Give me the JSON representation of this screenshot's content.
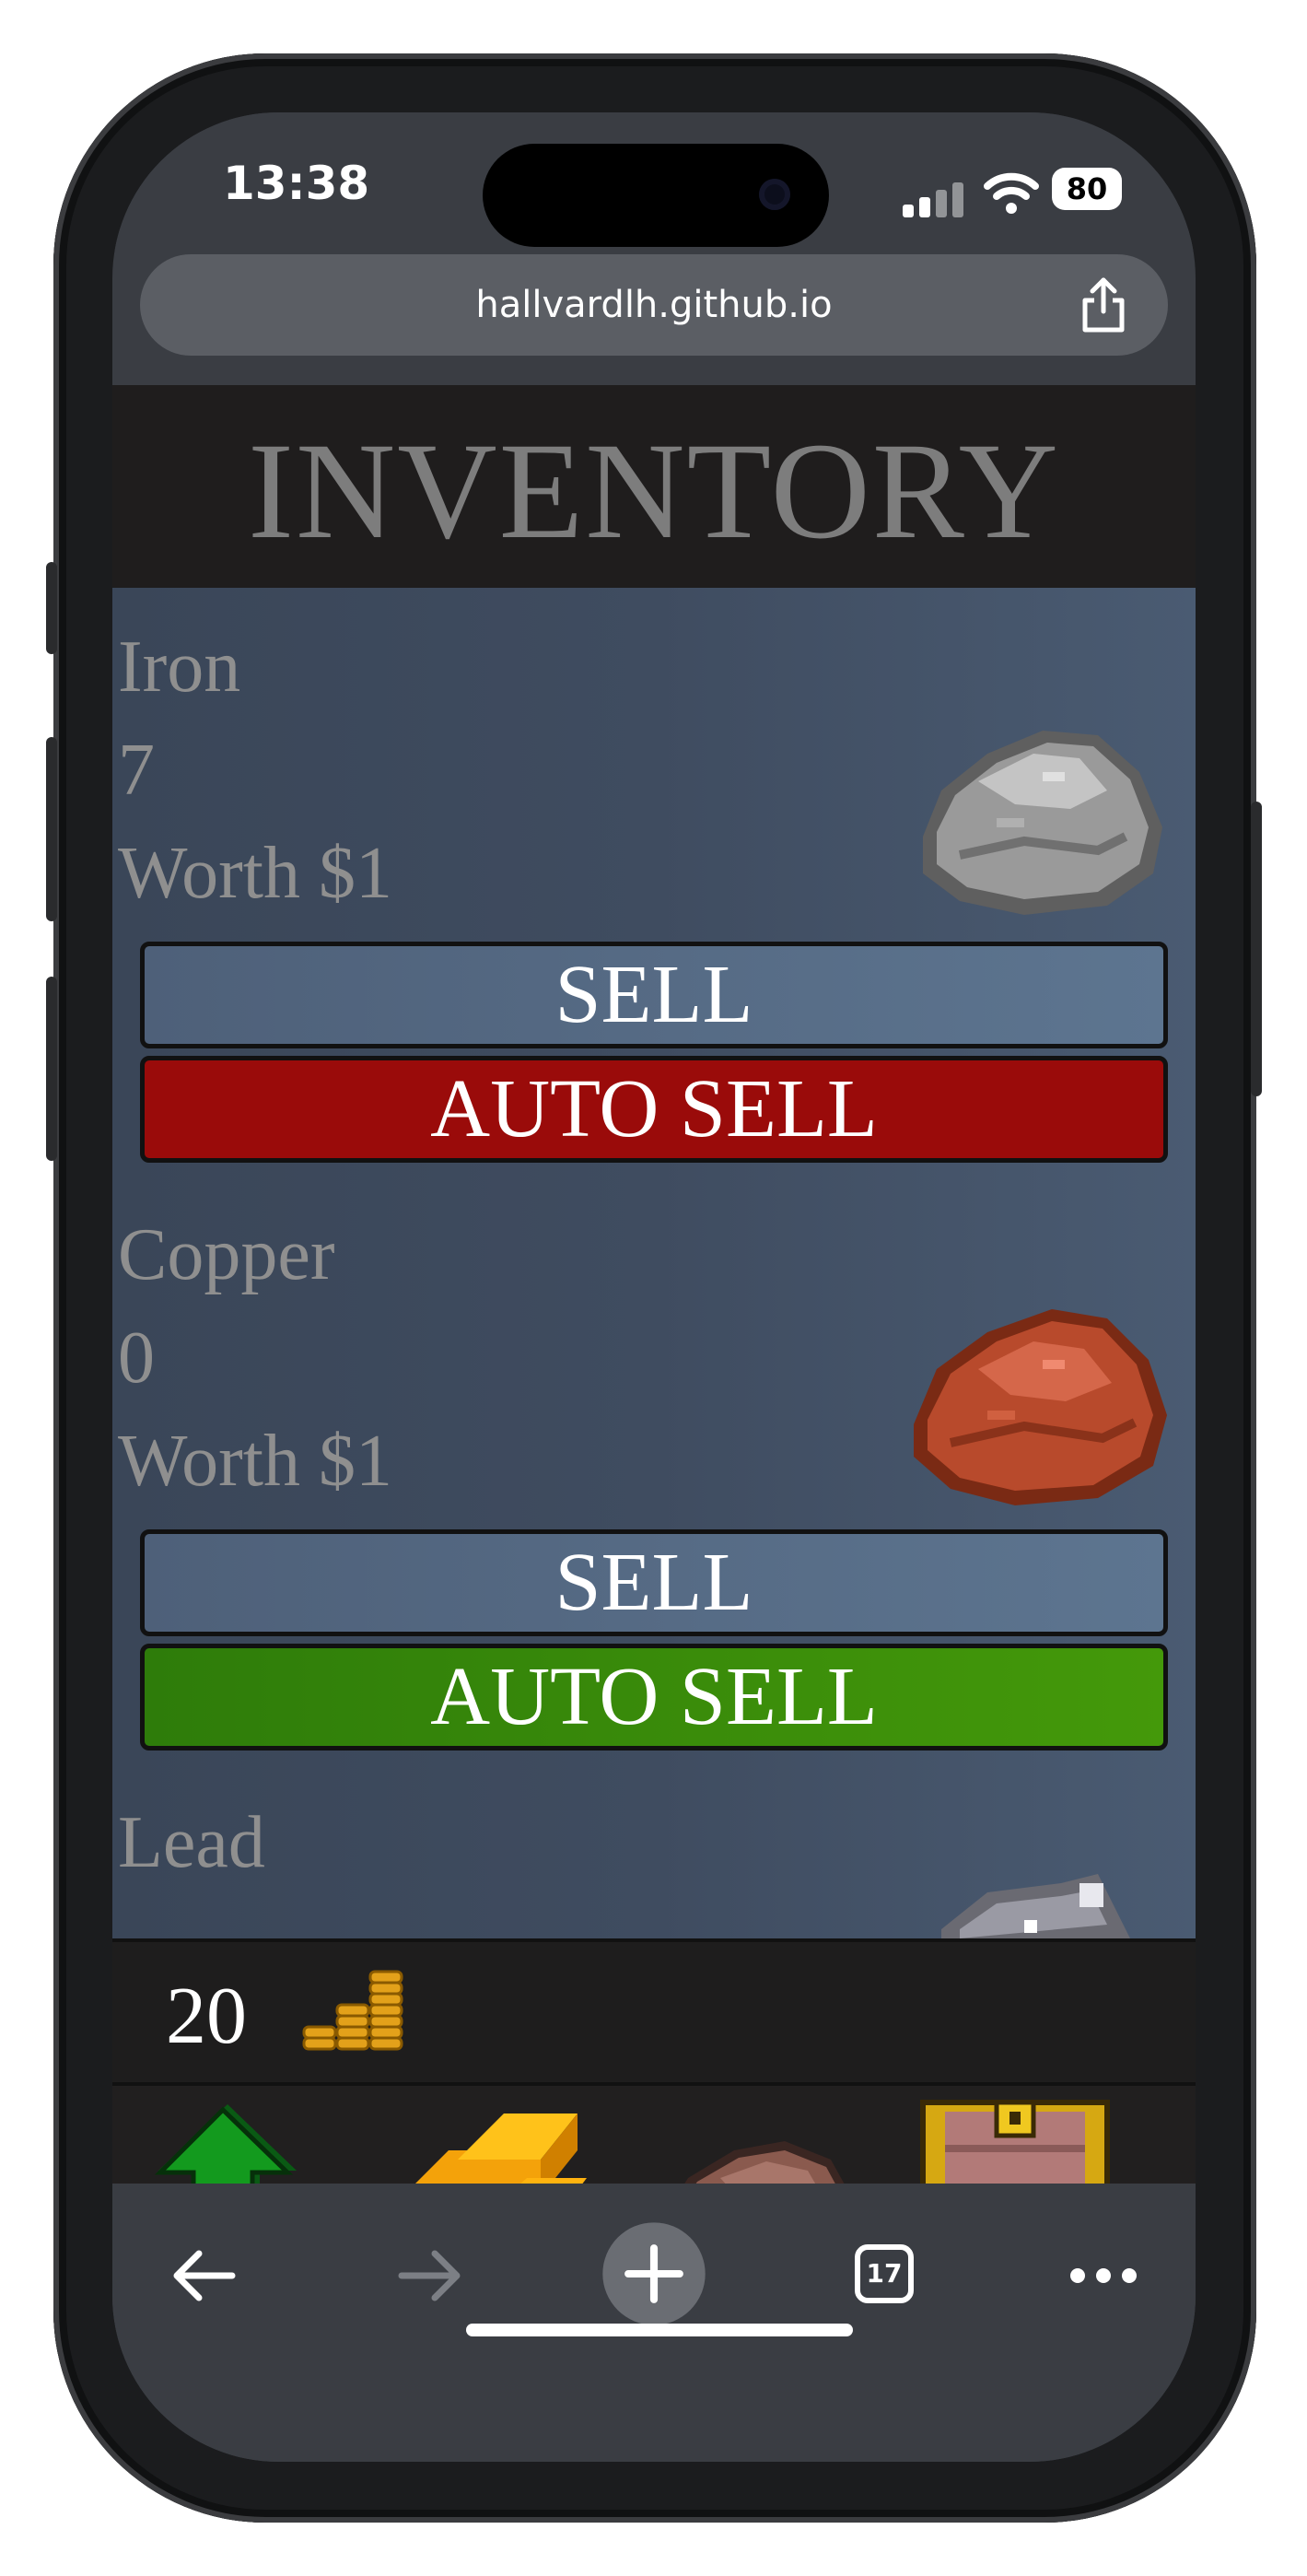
{
  "status": {
    "time": "13:38",
    "battery": "80"
  },
  "browser": {
    "url": "hallvardlh.github.io",
    "tab_count": "17"
  },
  "page": {
    "title": "INVENTORY",
    "items": [
      {
        "name": "Iron",
        "count": "7",
        "worth": "Worth $1",
        "sell_label": "SELL",
        "auto_sell_label": "AUTO SELL",
        "auto_sell_color": "#9a0b0a"
      },
      {
        "name": "Copper",
        "count": "0",
        "worth": "Worth $1",
        "sell_label": "SELL",
        "auto_sell_label": "AUTO SELL",
        "auto_sell_color": "#3f910a"
      },
      {
        "name": "Lead"
      }
    ],
    "money": "20",
    "nav": [
      "upgrade-arrow-icon",
      "gold-bars-icon",
      "ore-rock-icon",
      "treasure-chest-icon"
    ]
  }
}
